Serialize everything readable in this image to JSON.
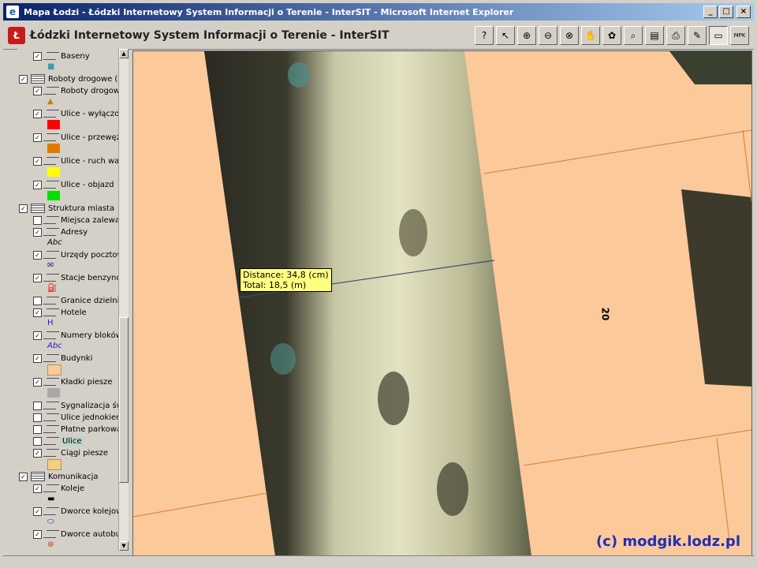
{
  "window": {
    "title": "Mapa Łodzi - Łódzki Internetowy System Informacji o Terenie - InterSIT - Microsoft Internet Explorer",
    "icon": "ie-icon",
    "buttons": [
      "minimize",
      "maximize",
      "close"
    ]
  },
  "app": {
    "title": "Łódzki Internetowy System Informacji o Terenie - InterSIT",
    "logo_text": "Ł"
  },
  "toolbar": [
    {
      "name": "help",
      "glyph": "?"
    },
    {
      "name": "select",
      "glyph": "↖"
    },
    {
      "name": "zoom-in",
      "glyph": "⊕"
    },
    {
      "name": "zoom-out",
      "glyph": "⊖"
    },
    {
      "name": "zoom-window",
      "glyph": "⊗"
    },
    {
      "name": "pan",
      "glyph": "✋"
    },
    {
      "name": "full-extent",
      "glyph": "✿"
    },
    {
      "name": "identify",
      "glyph": "⌕"
    },
    {
      "name": "report",
      "glyph": "▤"
    },
    {
      "name": "print",
      "glyph": "⎙"
    },
    {
      "name": "draw",
      "glyph": "✎"
    },
    {
      "name": "measure",
      "glyph": "▭"
    },
    {
      "name": "mpk",
      "glyph": "MPK"
    }
  ],
  "legend": {
    "layers": [
      {
        "kind": "layer",
        "checked": true,
        "label": "Baseny"
      },
      {
        "kind": "symbol",
        "color": "#3c9eaa",
        "glyph": "■"
      },
      {
        "kind": "group",
        "checked": true,
        "label": "Roboty drogowe (Za"
      },
      {
        "kind": "layer",
        "checked": true,
        "label": "Roboty drogowe"
      },
      {
        "kind": "symbol",
        "color": "#c08000",
        "glyph": "▲"
      },
      {
        "kind": "layer",
        "checked": true,
        "label": "Ulice - wyłączor"
      },
      {
        "kind": "swatch",
        "color": "#ff0000"
      },
      {
        "kind": "layer",
        "checked": true,
        "label": "Ulice - przewęże"
      },
      {
        "kind": "swatch",
        "color": "#e07b00"
      },
      {
        "kind": "layer",
        "checked": true,
        "label": "Ulice - ruch wah"
      },
      {
        "kind": "swatch",
        "color": "#ffff00"
      },
      {
        "kind": "layer",
        "checked": true,
        "label": "Ulice - objazd"
      },
      {
        "kind": "swatch",
        "color": "#00e000"
      },
      {
        "kind": "group",
        "checked": true,
        "label": "Struktura miasta"
      },
      {
        "kind": "layer",
        "checked": false,
        "label": "Miejsca zalewar"
      },
      {
        "kind": "layer",
        "checked": true,
        "label": "Adresy"
      },
      {
        "kind": "symbol",
        "color": "#000000",
        "glyph": "Abc"
      },
      {
        "kind": "layer",
        "checked": true,
        "label": "Urzędy pocztow"
      },
      {
        "kind": "symbol",
        "color": "#2020a0",
        "glyph": "✉"
      },
      {
        "kind": "layer",
        "checked": true,
        "label": "Stacje benzynov"
      },
      {
        "kind": "symbol",
        "color": "#000000",
        "glyph": "⛽"
      },
      {
        "kind": "layer",
        "checked": false,
        "label": "Granice dzielnic"
      },
      {
        "kind": "layer",
        "checked": true,
        "label": "Hotele"
      },
      {
        "kind": "symbol",
        "color": "#2020c0",
        "glyph": "H"
      },
      {
        "kind": "layer",
        "checked": true,
        "label": "Numery bloków"
      },
      {
        "kind": "symbol",
        "color": "#2020c0",
        "glyph": "Abc"
      },
      {
        "kind": "layer",
        "checked": true,
        "label": "Budynki"
      },
      {
        "kind": "swatch",
        "color": "#fcc99b"
      },
      {
        "kind": "layer",
        "checked": true,
        "label": "Kładki piesze"
      },
      {
        "kind": "swatch",
        "color": "#a8a8a8"
      },
      {
        "kind": "layer",
        "checked": false,
        "label": "Sygnalizacja świ"
      },
      {
        "kind": "layer",
        "checked": false,
        "label": "Ulice jednokieru"
      },
      {
        "kind": "layer",
        "checked": false,
        "label": "Płatne parkowa"
      },
      {
        "kind": "layer",
        "checked": false,
        "label": "Ulice",
        "selected": true
      },
      {
        "kind": "layer",
        "checked": true,
        "label": "Ciągi piesze"
      },
      {
        "kind": "swatch",
        "color": "#f3d080"
      },
      {
        "kind": "group",
        "checked": true,
        "label": "Komunikacja"
      },
      {
        "kind": "layer",
        "checked": true,
        "label": "Koleje"
      },
      {
        "kind": "symbol",
        "color": "#000000",
        "glyph": "▬"
      },
      {
        "kind": "layer",
        "checked": true,
        "label": "Dworce kolejow"
      },
      {
        "kind": "symbol",
        "color": "#2020c0",
        "glyph": "⬭"
      },
      {
        "kind": "layer",
        "checked": true,
        "label": "Dworce autobus"
      },
      {
        "kind": "symbol",
        "color": "#c04000",
        "glyph": "⊛"
      }
    ]
  },
  "map": {
    "tooltip_distance": "Distance: 34,8 (cm)",
    "tooltip_total": "Total: 18,5 (m)",
    "address_number": "20",
    "copyright": "(c) modgik.lodz.pl"
  }
}
